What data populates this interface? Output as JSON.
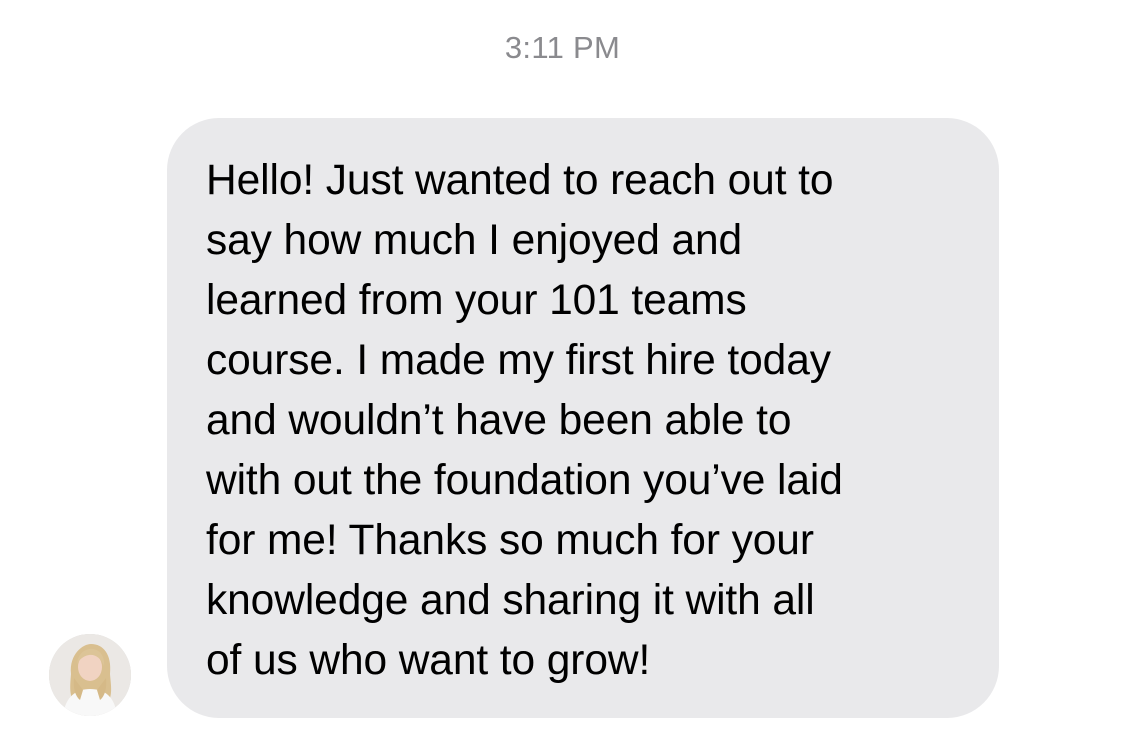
{
  "conversation": {
    "timestamp": "3:11 PM"
  },
  "message": {
    "sender_avatar_icon": "profile-photo-avatar",
    "bubble_color": "#e9e9eb",
    "text": "Hello! Just wanted to reach out to\nsay how much I enjoyed and\nlearned from your 101 teams\ncourse. I made my first hire today\nand wouldn’t have been able to\nwith out the foundation you’ve laid\nfor me! Thanks so much for your\nknowledge and sharing it with all\nof us who want to grow!"
  }
}
